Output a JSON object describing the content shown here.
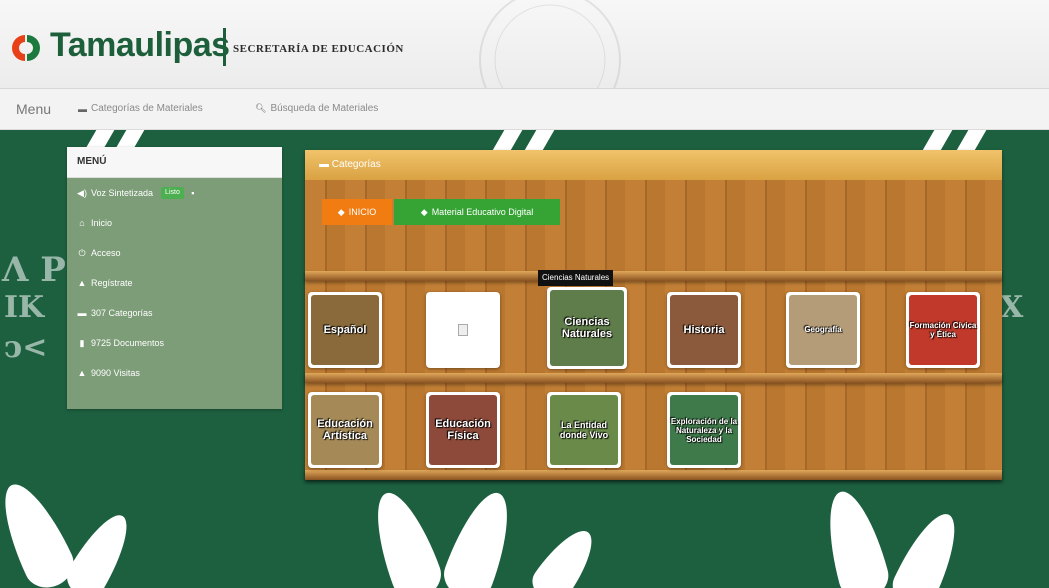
{
  "header": {
    "brand": "Tamaulipas",
    "subtitle": "SECRETARÍA DE EDUCACIÓN"
  },
  "navbar": {
    "brand": "Menu",
    "links": [
      {
        "icon": "folder-icon",
        "label": "Categorías de Materiales"
      },
      {
        "icon": "search-icon",
        "label": "Búsqueda de Materiales"
      }
    ]
  },
  "sidebar": {
    "title": "MENÚ",
    "items": [
      {
        "icon": "speaker-icon",
        "label": "Voz Sintetizada",
        "badge": "Listo"
      },
      {
        "icon": "home-icon",
        "label": "Inicio"
      },
      {
        "icon": "power-icon",
        "label": "Acceso"
      },
      {
        "icon": "user-icon",
        "label": "Regístrate"
      },
      {
        "icon": "folder-icon",
        "label": "307 Categorías"
      },
      {
        "icon": "document-icon",
        "label": "9725 Documentos"
      },
      {
        "icon": "user-icon",
        "label": "9090 Visitas"
      }
    ]
  },
  "panel": {
    "title": "Categorías",
    "home_button": "INICIO",
    "digital_button": "Material Educativo Digital",
    "tooltip": "Ciencias Naturales",
    "shelf1": [
      {
        "label": "Español",
        "color": "#8a6a3a"
      },
      {
        "label": "",
        "color": "#ffffff"
      },
      {
        "label": "Ciencias Naturales",
        "color": "#5f7d4a"
      },
      {
        "label": "Historia",
        "color": "#8b5a3c"
      },
      {
        "label": "Geografía",
        "color": "#b59c78"
      },
      {
        "label": "Formación Cívica y Ética",
        "color": "#c0392b"
      }
    ],
    "shelf2": [
      {
        "label": "Educación Artística",
        "color": "#a58a58"
      },
      {
        "label": "Educación Física",
        "color": "#8d4a3a"
      },
      {
        "label": "La Entidad donde Vivo",
        "color": "#6a8a4a"
      },
      {
        "label": "Exploración de la Naturaleza y la Sociedad",
        "color": "#3f7a4a"
      }
    ]
  },
  "colors": {
    "brand_green": "#1d5f3a",
    "orange_button": "#f07c12",
    "green_button": "#36a335"
  }
}
